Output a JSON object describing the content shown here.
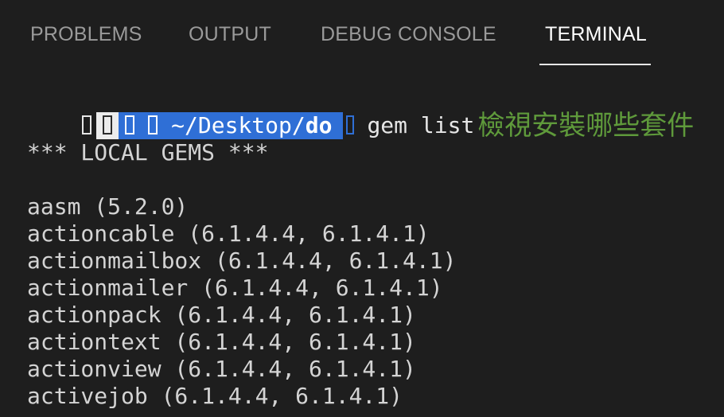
{
  "tabs": [
    {
      "label": "PROBLEMS",
      "active": false
    },
    {
      "label": "OUTPUT",
      "active": false
    },
    {
      "label": "DEBUG CONSOLE",
      "active": false
    },
    {
      "label": "TERMINAL",
      "active": true
    }
  ],
  "terminal": {
    "prompt": {
      "glyph_placeholders": [
        "▯",
        "▯",
        "▯",
        "▯",
        "▯"
      ],
      "path_prefix": "~/Desktop/",
      "path_dir": "do",
      "command": "gem list",
      "annotation": "檢視安裝哪些套件"
    },
    "header": "*** LOCAL GEMS ***",
    "gems": [
      "aasm (5.2.0)",
      "actioncable (6.1.4.4, 6.1.4.1)",
      "actionmailbox (6.1.4.4, 6.1.4.1)",
      "actionmailer (6.1.4.4, 6.1.4.1)",
      "actionpack (6.1.4.4, 6.1.4.1)",
      "actiontext (6.1.4.4, 6.1.4.1)",
      "actionview (6.1.4.4, 6.1.4.1)",
      "activejob (6.1.4.4, 6.1.4.1)"
    ]
  },
  "colors": {
    "background": "#1e1e1e",
    "tab_inactive": "#9a9a9a",
    "tab_active": "#ffffff",
    "prompt_highlight": "#2f6fd6",
    "annotation": "#5f9a3b"
  }
}
